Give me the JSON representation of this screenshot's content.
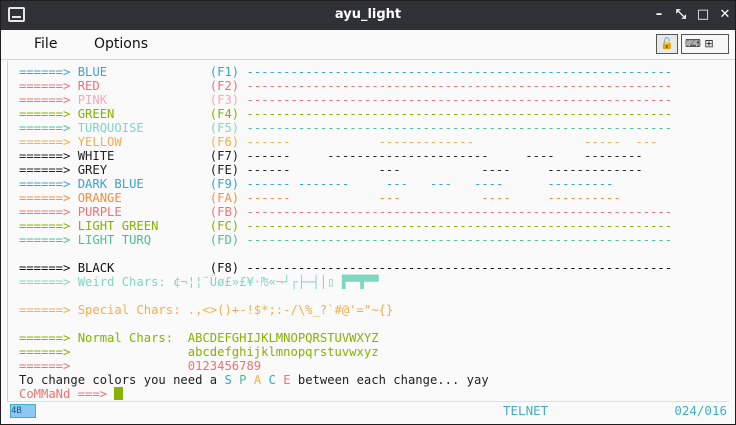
{
  "window": {
    "title": "ayu_light"
  },
  "menu": {
    "items": [
      "File",
      "Options"
    ]
  },
  "terminal": {
    "lines": [
      [
        {
          "text": "======>",
          "color": "#36a3d9"
        },
        {
          "text": " BLUE              ",
          "color": "#36a3d9"
        },
        {
          "text": "(F1)",
          "color": "#36a3d9"
        },
        {
          "text": " ----------------------------------------------------------",
          "color": "#36a3d9"
        }
      ],
      [
        {
          "text": "======>",
          "color": "#f07171"
        },
        {
          "text": " RED               ",
          "color": "#f07171"
        },
        {
          "text": "(F2)",
          "color": "#f07171"
        },
        {
          "text": " ----------------------------------------------------------",
          "color": "#f07171"
        }
      ],
      [
        {
          "text": "======>",
          "color": "#f07171"
        },
        {
          "text": " PINK              ",
          "color": "#f5a9b8"
        },
        {
          "text": "(F3)",
          "color": "#f5a9b8"
        },
        {
          "text": " ----------------------------------------------------------",
          "color": "#f07171"
        }
      ],
      [
        {
          "text": "======>",
          "color": "#86b300"
        },
        {
          "text": " GREEN             ",
          "color": "#86b300"
        },
        {
          "text": "(F4)",
          "color": "#86b300"
        },
        {
          "text": " ----------------------------------------------------------",
          "color": "#86b300"
        }
      ],
      [
        {
          "text": "======>",
          "color": "#4cbf99"
        },
        {
          "text": " TURQUOISE         ",
          "color": "#7fd6c2"
        },
        {
          "text": "(F5)",
          "color": "#7fd6c2"
        },
        {
          "text": " ----------------------------------------------------------",
          "color": "#4cbf99"
        }
      ],
      [
        {
          "text": "======>",
          "color": "#f2ae49"
        },
        {
          "text": " YELLOW            ",
          "color": "#f2ae49"
        },
        {
          "text": "(F6)",
          "color": "#f2ae49"
        },
        {
          "text": " ------            -------------               -----  ---",
          "color": "#f2ae49"
        }
      ],
      [
        {
          "text": "======> WHITE             (F7)",
          "color": "#222222"
        },
        {
          "text": " ------     ----------------------     ----    --------",
          "color": "#222222"
        }
      ],
      [
        {
          "text": "======> GREY              (FE)",
          "color": "#222222"
        },
        {
          "text": " ------            ---           ----     -------------",
          "color": "#222222"
        }
      ],
      [
        {
          "text": "======>",
          "color": "#36a3d9"
        },
        {
          "text": " DARK BLUE         ",
          "color": "#36a3d9"
        },
        {
          "text": "(F9)",
          "color": "#36a3d9"
        },
        {
          "text": " ------ -------     ---   ---   ----      ---------",
          "color": "#36a3d9"
        }
      ],
      [
        {
          "text": "======>",
          "color": "#fa8d3e"
        },
        {
          "text": " ORANGE            ",
          "color": "#fa8d3e"
        },
        {
          "text": "(FA)",
          "color": "#fa8d3e"
        },
        {
          "text": " ------            ---           ----     ----------",
          "color": "#fa8d3e"
        }
      ],
      [
        {
          "text": "======>",
          "color": "#f07171"
        },
        {
          "text": " PURPLE            ",
          "color": "#f07171"
        },
        {
          "text": "(FB)",
          "color": "#f07171"
        },
        {
          "text": " ----------------------------------------------------------",
          "color": "#f07171"
        }
      ],
      [
        {
          "text": "======>",
          "color": "#86b300"
        },
        {
          "text": " LIGHT GREEN       ",
          "color": "#86b300"
        },
        {
          "text": "(FC)",
          "color": "#86b300"
        },
        {
          "text": " ----------------------------------------------------------",
          "color": "#86b300"
        }
      ],
      [
        {
          "text": "======>",
          "color": "#4cbf99"
        },
        {
          "text": " LIGHT TURQ        ",
          "color": "#4cbf99"
        },
        {
          "text": "(FD)",
          "color": "#4cbf99"
        },
        {
          "text": " ----------------------------------------------------------",
          "color": "#4cbf99"
        }
      ],
      [],
      [
        {
          "text": "======> BLACK             (F8) ----------------------------------------------------------",
          "color": "#111111"
        }
      ],
      [
        {
          "text": "======> Weird Chars: ¢¬¦¦¨Üø£»£¥·₧«¬┘┌├─┤│▯ ▛▀▜▀▀",
          "color": "#7fd6c2"
        }
      ],
      [],
      [
        {
          "text": "======> Special Chars: .,<>()+-!$*;:-/\\%_?`#@'=\"~{}",
          "color": "#f2ae49"
        }
      ],
      [],
      [
        {
          "text": "======> Normal Chars:  ABCDEFGHIJKLMNOPQRSTUVWXYZ",
          "color": "#86b300"
        }
      ],
      [
        {
          "text": "======>                abcdefghijklmnopqrstuvwxyz",
          "color": "#86b300"
        }
      ],
      [
        {
          "text": "======>                0123456789",
          "color": "#f07171"
        }
      ],
      [
        {
          "text": "To change colors you need a ",
          "color": "#222222"
        },
        {
          "text": "S ",
          "color": "#36a3d9"
        },
        {
          "text": "P ",
          "color": "#4cbf99"
        },
        {
          "text": "A ",
          "color": "#f2ae49"
        },
        {
          "text": "C ",
          "color": "#36a3d9"
        },
        {
          "text": "E",
          "color": "#f07171"
        },
        {
          "text": " between each change... yay",
          "color": "#222222"
        }
      ],
      [
        {
          "text": "CoMMaNd ===> ",
          "color": "#f07171"
        }
      ]
    ]
  },
  "statusbar": {
    "protocol": "TELNET",
    "position": "024/016",
    "icon_label": "4B"
  },
  "colors": {
    "cursor": "#86b300"
  }
}
